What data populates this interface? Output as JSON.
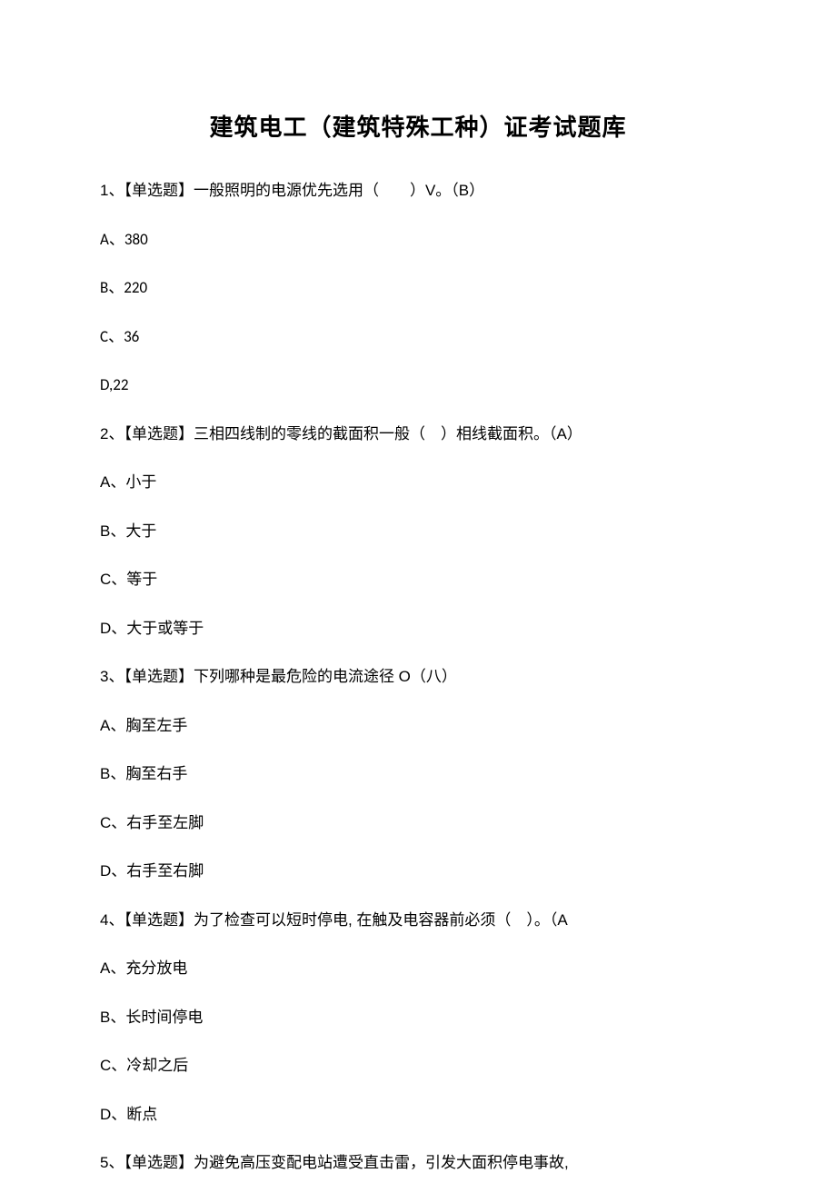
{
  "title": "建筑电工（建筑特殊工种）证考试题库",
  "q1": {
    "text": "1、【单选题】一般照明的电源优先选用（　　）V。（B）",
    "a": "A、380",
    "b": "B、220",
    "c": "C、36",
    "d": "D,22"
  },
  "q2": {
    "text": "2、【单选题】三相四线制的零线的截面积一般（　）相线截面积。（A）",
    "a": "A、小于",
    "b": "B、大于",
    "c": "C、等于",
    "d": "D、大于或等于"
  },
  "q3": {
    "text": "3、【单选题】下列哪种是最危险的电流途径 O（八）",
    "a": "A、胸至左手",
    "b": "B、胸至右手",
    "c": "C、右手至左脚",
    "d": "D、右手至右脚"
  },
  "q4": {
    "text": "4、【单选题】为了检查可以短时停电, 在触及电容器前必须（　）。（A",
    "a": "A、充分放电",
    "b": "B、长时间停电",
    "c": "C、冷却之后",
    "d": "D、断点"
  },
  "q5": {
    "text": "5、【单选题】为避免高压变配电站遭受直击雷，引发大面积停电事故,"
  }
}
